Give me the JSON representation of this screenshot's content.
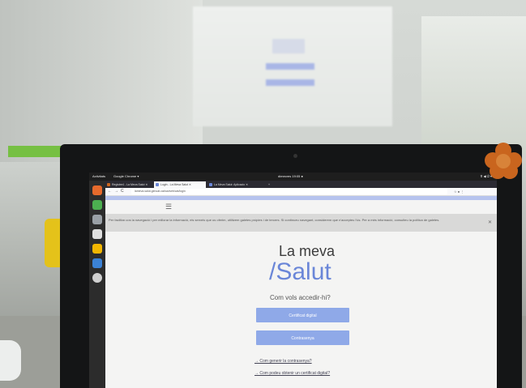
{
  "system_panel": {
    "activities": "Activitats",
    "app_name": "Google Chrome ▾",
    "clock": "dimecres 19:05 ●",
    "tray": "⊼ ◀ ⏻ ▾"
  },
  "browser": {
    "tabs": [
      {
        "label": "Registre4 - La Meva Salut ✕",
        "active": false,
        "icon_color": "#c9651e"
      },
      {
        "label": "Login - La Meva Salut ✕",
        "active": true,
        "icon_color": "#6a86d8"
      },
      {
        "label": "La Meva Salut: Aplicacio ✕",
        "active": false,
        "icon_color": "#6a86d8"
      }
    ],
    "new_tab": "+",
    "url": "lameva.salut.gencat.cat/ca/web/cat/login",
    "nav": {
      "back": "←",
      "forward": "→",
      "reload": "C"
    },
    "toolbar_right": "☆  ●  ⋮"
  },
  "dock_icons": [
    {
      "name": "firefox-icon",
      "color": "#e66a2c"
    },
    {
      "name": "chrome-icon",
      "color": "#4caf50"
    },
    {
      "name": "files-icon",
      "color": "#9aa0a6"
    },
    {
      "name": "software-icon",
      "color": "#e0e0e0"
    },
    {
      "name": "impress-icon",
      "color": "#f2b600"
    },
    {
      "name": "writer-icon",
      "color": "#3b82d6"
    },
    {
      "name": "help-icon",
      "color": "#d0d0d0"
    }
  ],
  "page": {
    "menu_glyph": "☰",
    "cookie_notice": "Per facilitar-vos la navegació i per millorar la informació, els serveis que us oferim, utilitzem galetes pròpies i de tercers. Si continueu navegant, considerem que n'accepteu l'ús. Per a més informació, consulteu la política de galetes.",
    "cookie_close": "✕",
    "title_line1": "La meva",
    "title_line2": "/Salut",
    "question": "Com vols accedir-hi?",
    "btn_certificat": "Certificat digital",
    "btn_contrasenya": "Contrasenya",
    "link_password": "→ Com generir la contrasenya?",
    "link_certificate": "→ Com podeu obtenir un certificat digital?"
  }
}
